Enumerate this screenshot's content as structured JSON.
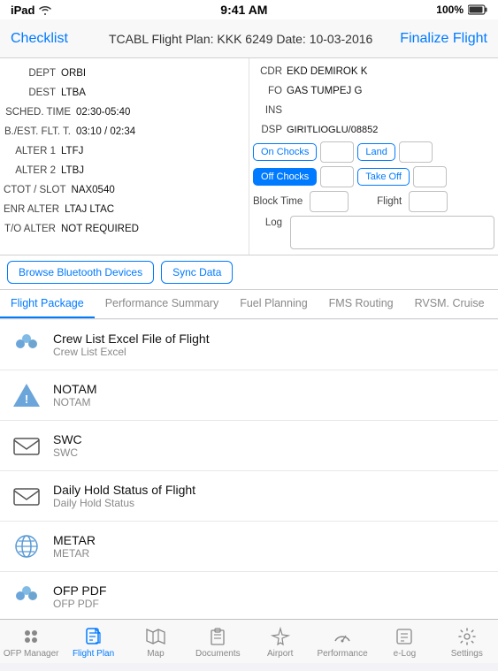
{
  "statusBar": {
    "left": "iPad",
    "time": "9:41 AM",
    "battery": "100%"
  },
  "navBar": {
    "leftBtn": "Checklist",
    "title": "TCABL Flight Plan: KKK 6249 Date: 10-03-2016",
    "rightBtn": "Finalize Flight"
  },
  "leftFields": [
    {
      "label": "DEPT",
      "value": "ORBI"
    },
    {
      "label": "DEST",
      "value": "LTBA"
    },
    {
      "label": "SCHED. TIME",
      "value": "02:30-05:40"
    },
    {
      "label": "B./EST. FLT. T.",
      "value": "03:10 / 02:34"
    },
    {
      "label": "ALTER 1",
      "value": "LTFJ"
    },
    {
      "label": "ALTER 2",
      "value": "LTBJ"
    },
    {
      "label": "CTOT / SLOT",
      "value": "NAX0540"
    },
    {
      "label": "ENR ALTER",
      "value": "LTAJ  LTAC"
    },
    {
      "label": "T/O ALTER",
      "value": "NOT REQUIRED"
    }
  ],
  "rightFields": {
    "cdr": {
      "label": "CDR",
      "value": "EKD DEMIROK K"
    },
    "fo": {
      "label": "FO",
      "value": "GAS TUMPEJ  G"
    },
    "ins": {
      "label": "INS",
      "value": ""
    },
    "dsp": {
      "label": "DSP",
      "value": "GIRITLIOGLU/08852"
    },
    "onChocks": "On Chocks",
    "land": "Land",
    "offChocks": "Off Chocks",
    "takeOff": "Take Off",
    "blockTime": "Block Time",
    "flight": "Flight",
    "log": "Log"
  },
  "actions": {
    "bluetooth": "Browse Bluetooth Devices",
    "sync": "Sync Data"
  },
  "tabs": [
    {
      "label": "Flight Package",
      "active": true
    },
    {
      "label": "Performance Summary",
      "active": false
    },
    {
      "label": "Fuel Planning",
      "active": false
    },
    {
      "label": "FMS Routing",
      "active": false
    },
    {
      "label": "RVSM. Cruise",
      "active": false
    }
  ],
  "fileList": [
    {
      "title": "Crew List Excel File of Flight",
      "subtitle": "Crew List Excel",
      "iconType": "drops"
    },
    {
      "title": "NOTAM",
      "subtitle": "NOTAM",
      "iconType": "triangle"
    },
    {
      "title": "SWC",
      "subtitle": "SWC",
      "iconType": "envelope"
    },
    {
      "title": "Daily Hold Status of Flight",
      "subtitle": "Daily Hold Status",
      "iconType": "envelope"
    },
    {
      "title": "METAR",
      "subtitle": "METAR",
      "iconType": "globe"
    },
    {
      "title": "OFP PDF",
      "subtitle": "OFP PDF",
      "iconType": "drops"
    }
  ],
  "bottomTabs": [
    {
      "label": "OFP Manager",
      "icon": "grid",
      "active": false
    },
    {
      "label": "Flight Plan",
      "icon": "doc",
      "active": true
    },
    {
      "label": "Map",
      "icon": "map",
      "active": false
    },
    {
      "label": "Documents",
      "icon": "clipboard",
      "active": false
    },
    {
      "label": "Airport",
      "icon": "plane",
      "active": false
    },
    {
      "label": "Performance",
      "icon": "gauge",
      "active": false
    },
    {
      "label": "e-Log",
      "icon": "elog",
      "active": false
    },
    {
      "label": "Settings",
      "icon": "gear",
      "active": false
    }
  ]
}
